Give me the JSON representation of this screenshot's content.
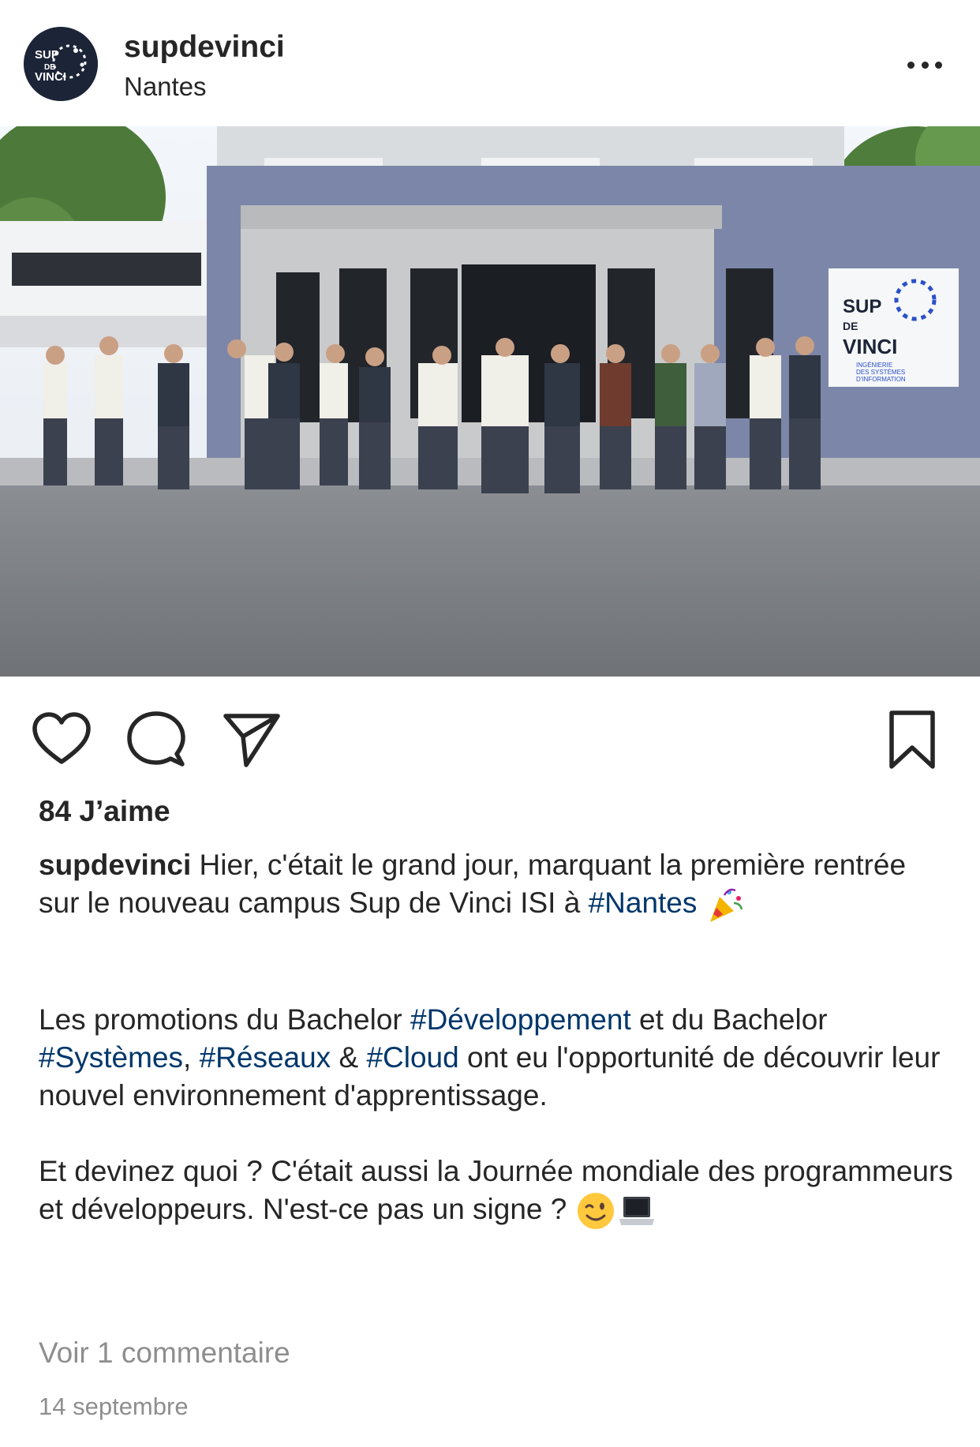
{
  "post": {
    "username": "supdevinci",
    "location": "Nantes",
    "avatar_text": [
      "SUP",
      "DE",
      "VINCI"
    ],
    "photo_sign": {
      "line1": "SUP",
      "line2": "DE",
      "line3": "VINCI",
      "subtitle": [
        "INGÉNIERIE",
        "DES SYSTÈMES",
        "D'INFORMATION"
      ]
    },
    "likes": "84 J’aime",
    "caption": {
      "user": "supdevinci",
      "p1_text": " Hier, c'était le grand jour, marquant la première rentrée sur le nouveau campus Sup de Vinci ISI à ",
      "p1_tag": "#Nantes",
      "p2_a": "Les promotions du Bachelor ",
      "p2_tag1": "#Développement",
      "p2_b": " et du Bachelor ",
      "p2_tag2": "#Systèmes",
      "p2_c": ", ",
      "p2_tag3": "#Réseaux",
      "p2_d": " & ",
      "p2_tag4": "#Cloud",
      "p2_e": " ont eu l'opportunité de découvrir leur nouvel environnement d'apprentissage.",
      "p3": "Et devinez quoi ? C'était aussi la Journée mondiale des programmeurs et développeurs. N'est-ce pas un signe ? "
    },
    "comments_link": "Voir 1 commentaire",
    "date": "14 septembre",
    "icons": {
      "like": "heart-icon",
      "comment": "comment-icon",
      "share": "send-icon",
      "save": "bookmark-icon",
      "more": "more-icon",
      "emoji1": "party-popper-icon",
      "emoji2": "winking-face-icon",
      "emoji3": "laptop-icon"
    },
    "colors": {
      "text": "#262626",
      "hashtag": "#00376b",
      "secondary": "#8e8e8e",
      "brand_navy": "#1c2438",
      "brand_blue": "#2b50c8"
    }
  }
}
